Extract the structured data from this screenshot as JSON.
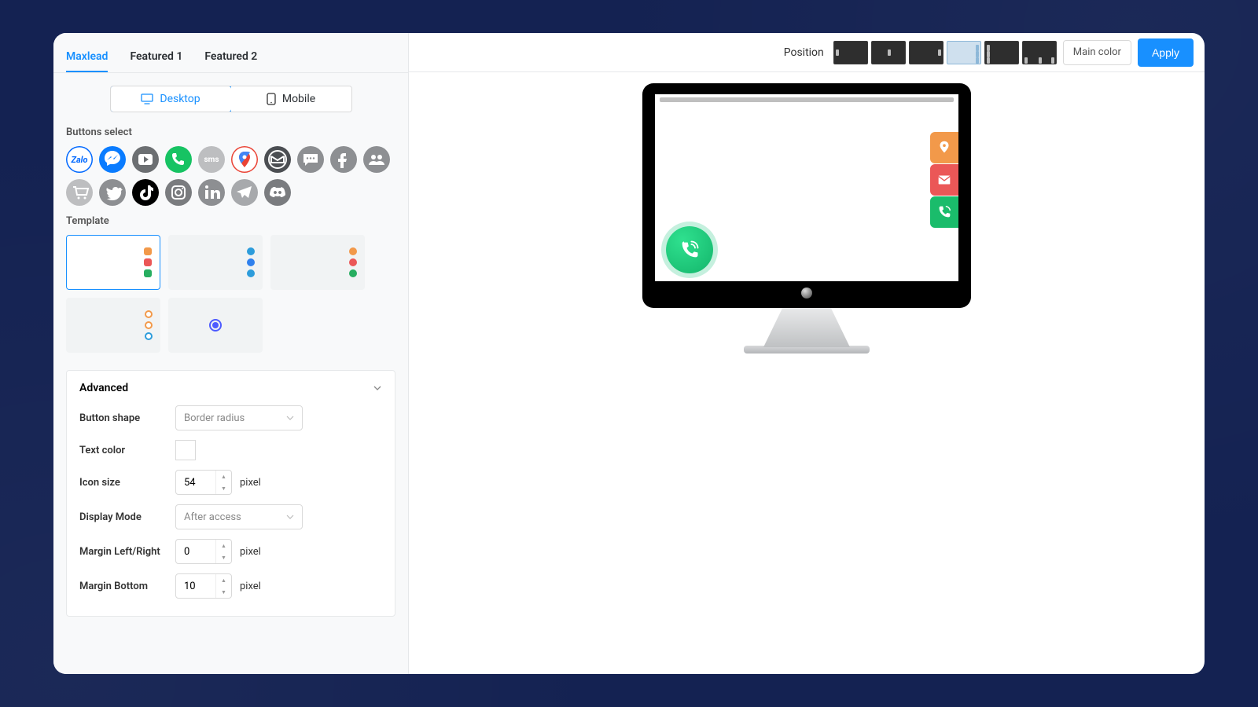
{
  "tabs": {
    "items": [
      "Maxlead",
      "Featured 1",
      "Featured 2"
    ],
    "active": 0
  },
  "device": {
    "desktop": "Desktop",
    "mobile": "Mobile",
    "active": "desktop"
  },
  "sections": {
    "buttons_select": "Buttons select",
    "template": "Template"
  },
  "channels": [
    {
      "name": "zalo",
      "label": "Zalo",
      "bg": "#ffffff",
      "fg": "#0068ff",
      "outline": true
    },
    {
      "name": "messenger",
      "label": "Messenger",
      "bg": "#0a7cff",
      "fg": "#ffffff"
    },
    {
      "name": "youtube",
      "label": "YouTube",
      "bg": "#6c6f72",
      "fg": "#ffffff"
    },
    {
      "name": "phone",
      "label": "Phone",
      "bg": "#17c363",
      "fg": "#ffffff"
    },
    {
      "name": "sms",
      "label": "SMS",
      "bg": "#bdbec0",
      "fg": "#ffffff"
    },
    {
      "name": "maps",
      "label": "Google Maps",
      "bg": "#ffffff",
      "fg": "#ea4335",
      "outline": true,
      "multi": true
    },
    {
      "name": "email",
      "label": "Email",
      "bg": "#4b4e52",
      "fg": "#ffffff"
    },
    {
      "name": "chat",
      "label": "Chat",
      "bg": "#8d8f92",
      "fg": "#ffffff"
    },
    {
      "name": "facebook",
      "label": "Facebook",
      "bg": "#8d8f92",
      "fg": "#ffffff"
    },
    {
      "name": "group",
      "label": "Group",
      "bg": "#8d8f92",
      "fg": "#ffffff"
    },
    {
      "name": "cart",
      "label": "Cart",
      "bg": "#bdbec0",
      "fg": "#ffffff"
    },
    {
      "name": "twitter",
      "label": "Twitter",
      "bg": "#8d8f92",
      "fg": "#ffffff"
    },
    {
      "name": "tiktok",
      "label": "TikTok",
      "bg": "#000000",
      "fg": "#ffffff"
    },
    {
      "name": "instagram",
      "label": "Instagram",
      "bg": "#7a7c7f",
      "fg": "#ffffff"
    },
    {
      "name": "linkedin",
      "label": "LinkedIn",
      "bg": "#8d8f92",
      "fg": "#ffffff"
    },
    {
      "name": "telegram",
      "label": "Telegram",
      "bg": "#a7a9ac",
      "fg": "#ffffff"
    },
    {
      "name": "discord",
      "label": "Discord",
      "bg": "#7a7c7f",
      "fg": "#ffffff"
    }
  ],
  "templates": [
    {
      "id": 1,
      "style": "square",
      "colors": [
        "#f2994a",
        "#eb5757",
        "#27ae60"
      ],
      "selected": true
    },
    {
      "id": 2,
      "style": "circle",
      "colors": [
        "#2d9cdb",
        "#2f80ed",
        "#2d9cdb"
      ]
    },
    {
      "id": 3,
      "style": "circle",
      "colors": [
        "#f2994a",
        "#eb5757",
        "#27ae60"
      ]
    },
    {
      "id": 4,
      "style": "outline",
      "colors": [
        "#f2994a",
        "#f2994a",
        "#2d9cdb"
      ]
    },
    {
      "id": 5,
      "style": "center"
    }
  ],
  "advanced": {
    "title": "Advanced",
    "button_shape": {
      "label": "Button shape",
      "value": "Border radius"
    },
    "text_color": {
      "label": "Text color",
      "value": "#ffffff"
    },
    "icon_size": {
      "label": "Icon size",
      "value": 54,
      "unit": "pixel"
    },
    "display_mode": {
      "label": "Display Mode",
      "value": "After access"
    },
    "margin_lr": {
      "label": "Margin Left/Right",
      "value": 0,
      "unit": "pixel"
    },
    "margin_bottom": {
      "label": "Margin Bottom",
      "value": 10,
      "unit": "pixel"
    }
  },
  "topbar": {
    "position_label": "Position",
    "main_color_label": "Main color",
    "apply_label": "Apply",
    "positions": [
      "bottom-left",
      "bottom-center",
      "bottom-right",
      "middle-right",
      "middle-left",
      "spread"
    ],
    "selected": 3
  },
  "preview": {
    "stack": [
      {
        "icon": "location",
        "bg": "#f2994a"
      },
      {
        "icon": "mail",
        "bg": "#eb5757"
      },
      {
        "icon": "phone",
        "bg": "#1abc6b"
      }
    ],
    "call_bubble": true
  }
}
